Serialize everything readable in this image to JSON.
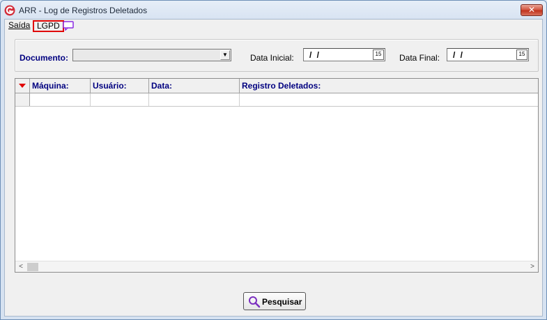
{
  "window": {
    "title": "ARR - Log de Registros Deletados",
    "close_label": "✕"
  },
  "menu": {
    "saida": "Saída",
    "lgpd": "LGPD"
  },
  "filters": {
    "documento_label": "Documento:",
    "documento_value": "",
    "data_inicial_label": "Data Inicial:",
    "data_inicial_value": "/ /",
    "data_final_label": "Data Final:",
    "data_final_value": "/ /",
    "calendar_label": "15"
  },
  "grid": {
    "columns": [
      "Máquina:",
      "Usuário:",
      "Data:",
      "Registro Deletados:"
    ],
    "rows": [
      [
        "",
        "",
        "",
        ""
      ]
    ]
  },
  "buttons": {
    "pesquisar": "Pesquisar"
  },
  "icons": {
    "app": "app-logo-icon",
    "chat": "chat-icon",
    "search": "magnifier-icon",
    "calendar": "calendar-icon"
  },
  "colors": {
    "header_text": "#000080",
    "highlight": "#e00000",
    "accent_purple": "#8a2be2"
  }
}
